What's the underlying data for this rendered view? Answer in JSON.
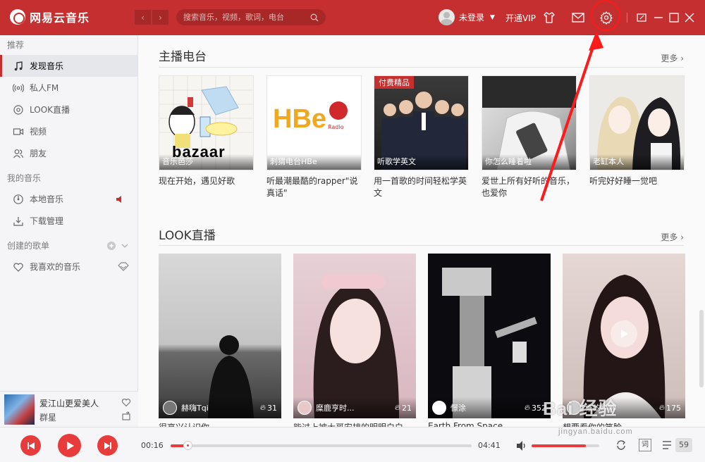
{
  "app": {
    "title": "网易云音乐"
  },
  "search": {
    "placeholder": "搜索音乐，视频，歌词，电台"
  },
  "user": {
    "name": "未登录",
    "vip_label": "开通VIP"
  },
  "sidebar": {
    "sections": [
      {
        "title": "推荐",
        "items": [
          {
            "label": "发现音乐",
            "icon": "music-note-icon",
            "active": true
          },
          {
            "label": "私人FM",
            "icon": "radio-waves-icon"
          },
          {
            "label": "LOOK直播",
            "icon": "live-icon"
          },
          {
            "label": "视频",
            "icon": "video-icon"
          },
          {
            "label": "朋友",
            "icon": "friends-icon"
          }
        ]
      },
      {
        "title": "我的音乐",
        "items": [
          {
            "label": "本地音乐",
            "icon": "disc-icon"
          },
          {
            "label": "下载管理",
            "icon": "download-icon"
          }
        ]
      },
      {
        "title": "创建的歌单",
        "items": [
          {
            "label": "我喜欢的音乐",
            "icon": "heart-icon"
          }
        ]
      }
    ]
  },
  "now_playing": {
    "title": "爱江山更爱美人",
    "artist": "群星"
  },
  "radio": {
    "title": "主播电台",
    "more": "更多",
    "cards": [
      {
        "caption": "音乐芭莎",
        "desc": "现在开始，遇见好歌"
      },
      {
        "caption": "刺猬电台HBe",
        "desc": "听最潮最酷的rapper\"说真话\"",
        "logo_text": "HBe",
        "logo_sub": "Radio"
      },
      {
        "caption": "听歌学英文",
        "desc": "用一首歌的时间轻松学英文",
        "badge": "付费精品"
      },
      {
        "caption": "你怎么睡着啦",
        "desc": "爱世上所有好听的音乐，也爱你"
      },
      {
        "caption": "老缸本人",
        "desc": "听完好好睡一觉吧"
      }
    ],
    "bazaar_text": "bazaar"
  },
  "look": {
    "title": "LOOK直播",
    "more": "更多",
    "cards": [
      {
        "host": "赫嗨Tqi",
        "count": "31",
        "desc": "很高兴认识你"
      },
      {
        "host": "糜鹿亨时...",
        "count": "21",
        "desc": "能过上被大哥安排的明明白白"
      },
      {
        "host": "憬涂",
        "count": "352",
        "desc": "Earth From Space"
      },
      {
        "host": "谁的小静",
        "count": "175",
        "desc": "想要看你的笑脸"
      }
    ]
  },
  "player": {
    "current_time": "00:16",
    "total_time": "04:41",
    "progress": 0.057,
    "volume": 0.8,
    "lyric_label": "词",
    "playlist_count": "59"
  },
  "watermark": {
    "text": "Bai 经验",
    "sub": "jingyan.baidu.com"
  },
  "colors": {
    "brand": "#c62f2f",
    "accent": "#e83c3c"
  }
}
